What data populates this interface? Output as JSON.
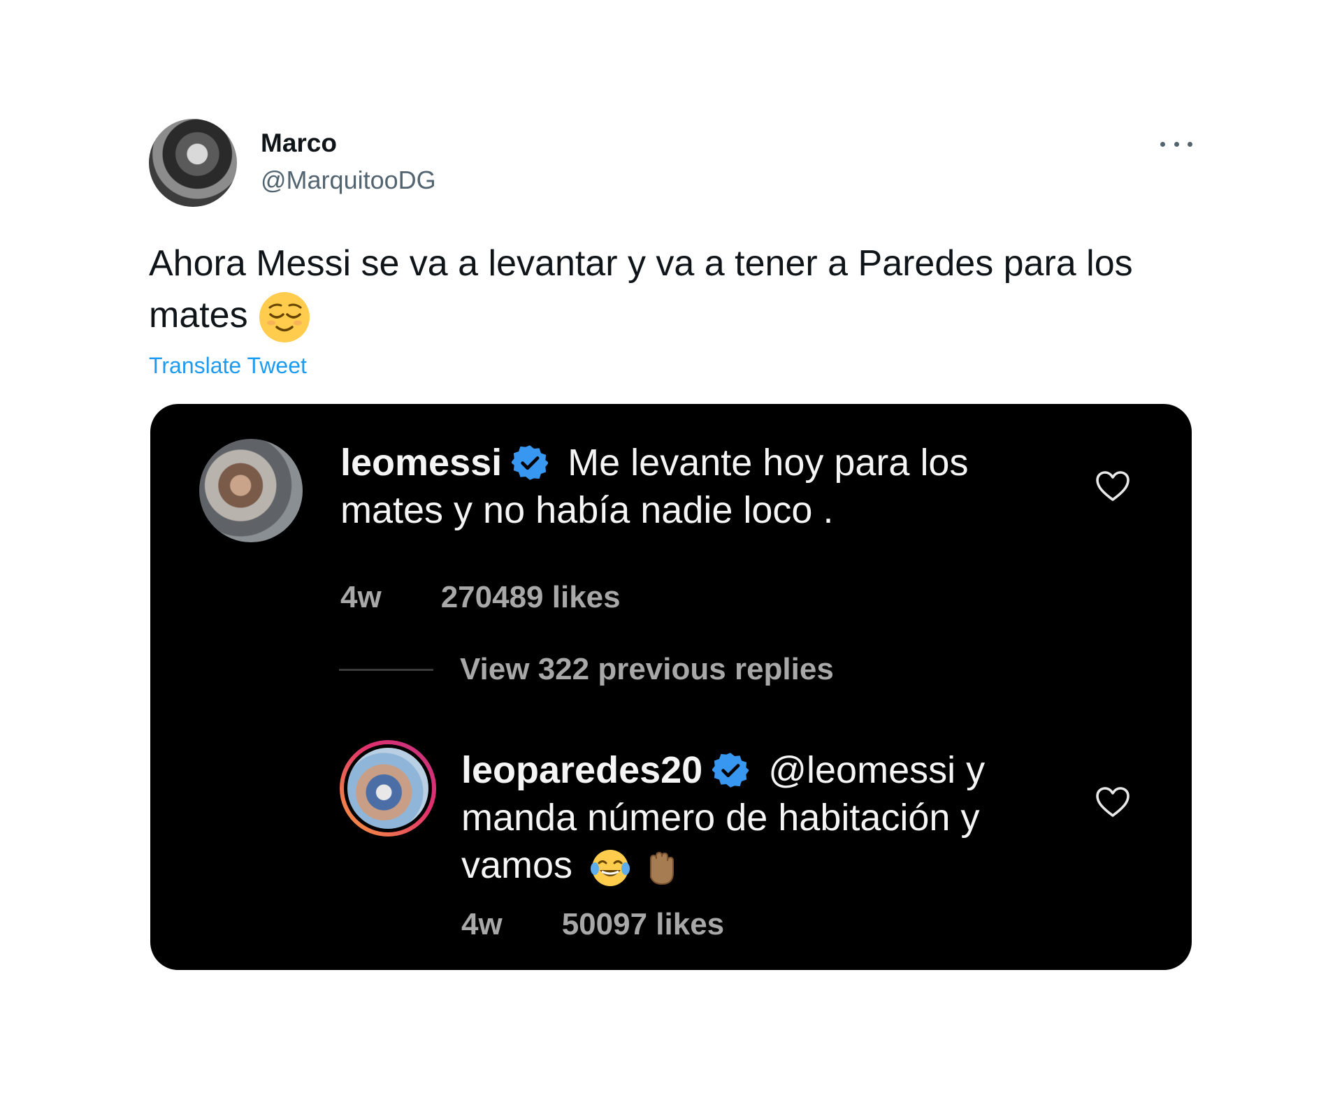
{
  "tweet": {
    "name": "Marco",
    "handle": "@MarquitooDG",
    "text": "Ahora Messi se va a levantar y va a tener a Paredes para los mates",
    "translate_label": "Translate Tweet"
  },
  "instagram": {
    "comments": [
      {
        "username": "leomessi",
        "text": "Me levante hoy para los mates y no había nadie loco .",
        "age": "4w",
        "likes": "270489 likes"
      },
      {
        "username": "leoparedes20",
        "text": "@leomessi y manda número de habitación y vamos",
        "age": "4w",
        "likes": "50097 likes"
      }
    ],
    "view_replies_label": "View 322 previous replies"
  },
  "colors": {
    "link": "#1d9bf0",
    "verified": "#3897f0",
    "card_bg": "#000000"
  }
}
